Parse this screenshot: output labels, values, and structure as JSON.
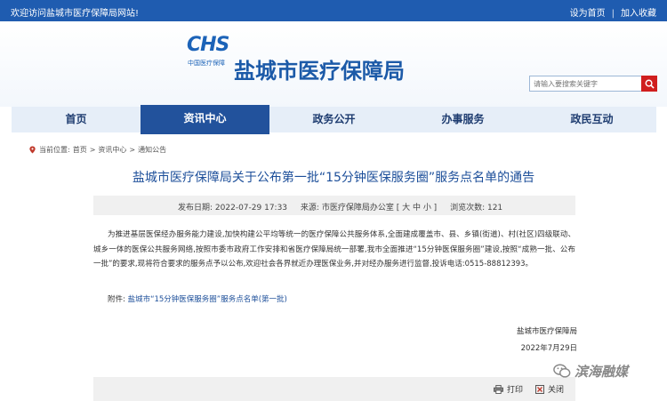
{
  "topbar": {
    "welcome": "欢迎访问盐城市医疗保障局网站!",
    "set_home": "设为首页",
    "separator": "|",
    "favorite": "加入收藏"
  },
  "header": {
    "logo_abbr": "CHS",
    "logo_sub": "中国医疗保障",
    "site_title": "盐城市医疗保障局"
  },
  "search": {
    "placeholder": "请输入要搜索关键字"
  },
  "nav": {
    "items": [
      {
        "label": "首页"
      },
      {
        "label": "资讯中心"
      },
      {
        "label": "政务公开"
      },
      {
        "label": "办事服务"
      },
      {
        "label": "政民互动"
      }
    ]
  },
  "breadcrumb": {
    "prefix": "当前位置:",
    "home": "首页",
    "sep1": ">",
    "section": "资讯中心",
    "sep2": ">",
    "current": "通知公告"
  },
  "article": {
    "title": "盐城市医疗保障局关于公布第一批“15分钟医保服务圈”服务点名单的通告",
    "publish_label": "发布日期:",
    "publish_date": "2022-07-29 17:33",
    "source_label": "来源:",
    "source": "市医疗保障局办公室",
    "font_size_ctrl": "[ 大 中 小 ]",
    "views_label": "浏览次数:",
    "views": "121",
    "body": "为推进基层医保经办服务能力建设,加快构建公平均等统一的医疗保障公共服务体系,全面建成覆盖市、县、乡镇(街道)、村(社区)四级联动、城乡一体的医保公共服务网络,按照市委市政府工作安排和省医疗保障局统一部署,我市全面推进“15分钟医保服务圈”建设,按照“成熟一批、公布一批”的要求,现将符合要求的服务点予以公布,欢迎社会各界就近办理医保业务,并对经办服务进行监督,投诉电话:0515-88812393。",
    "attachment_label": "附件:",
    "attachment_link": "盐城市“15分钟医保服务圈”服务点名单(第一批)",
    "sign_org": "盐城市医疗保障局",
    "sign_date": "2022年7月29日"
  },
  "footer": {
    "print": "打印",
    "close": "关闭"
  },
  "watermark": {
    "text": "滨海融媒"
  },
  "colors": {
    "topbar": "#1f5cb0",
    "nav_bg": "#e6eef8",
    "nav_active": "#22529c",
    "title": "#1d4f9a",
    "search_button": "#d01e1e"
  }
}
